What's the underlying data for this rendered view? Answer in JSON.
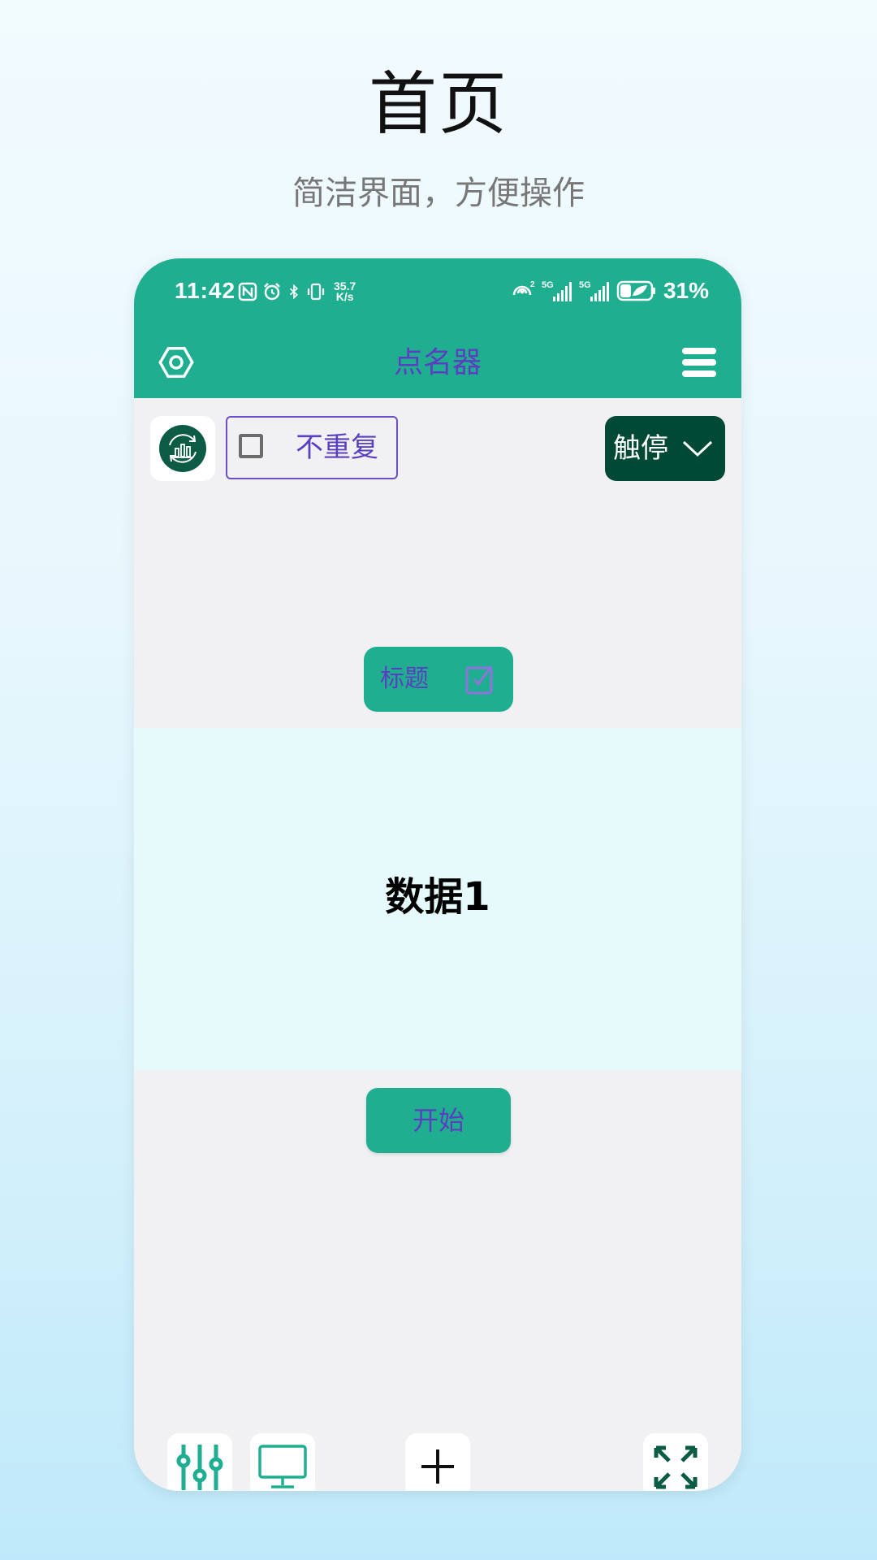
{
  "promo": {
    "title": "首页",
    "subtitle": "简洁界面，方便操作"
  },
  "status_bar": {
    "time": "11:42",
    "net_speed_value": "35.7",
    "net_speed_unit": "K/s",
    "hotspot_badge": "2",
    "network_1": "5G",
    "network_2": "5G",
    "battery_percent": "31%",
    "icons": [
      "nfc-icon",
      "alarm-icon",
      "bluetooth-icon",
      "vibrate-icon",
      "hotspot-icon",
      "signal-icon",
      "battery-saver-icon"
    ]
  },
  "app_bar": {
    "title": "点名器",
    "left_icon": "settings-hexagon-icon",
    "right_icon": "menu-icon"
  },
  "toolbar": {
    "stats_icon": "stats-refresh-icon",
    "no_repeat_label": "不重复",
    "no_repeat_checked": false,
    "mode_selected": "触停",
    "mode_icon": "chevron-down-icon"
  },
  "title_button": {
    "label": "标题",
    "icon": "edit-icon"
  },
  "display": {
    "value": "数据1"
  },
  "start_button": {
    "label": "开始"
  },
  "bottom_bar": {
    "icons": [
      "sliders-icon",
      "monitor-icon",
      "plus-icon",
      "expand-icon"
    ]
  },
  "colors": {
    "accent": "#20ae90",
    "dark_accent": "#004a35",
    "text_purple": "#5a3fc0",
    "panel_bg": "#e6fafb",
    "screen_bg": "#f1f1f3"
  }
}
